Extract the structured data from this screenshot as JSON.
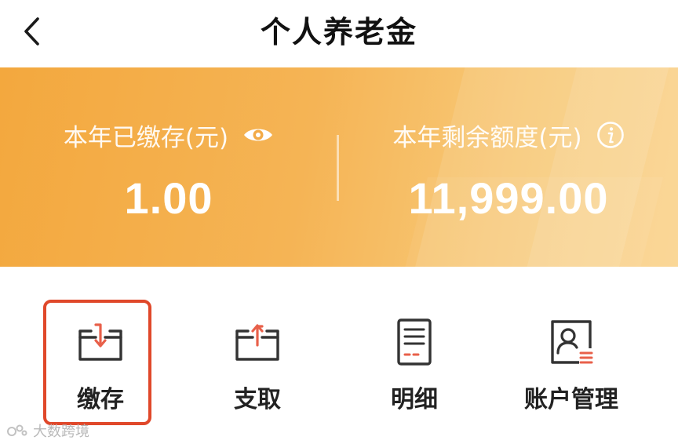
{
  "header": {
    "title": "个人养老金",
    "back_icon": "chevron-left-icon"
  },
  "banner": {
    "colors": {
      "gradient_start": "#f3a83e",
      "gradient_end": "#fad38c",
      "text": "#ffffff"
    },
    "paid": {
      "label": "本年已缴存(元)",
      "value": "1.00",
      "icon": "eye-icon"
    },
    "remaining": {
      "label": "本年剩余额度(元)",
      "value": "11,999.00",
      "icon": "info-icon"
    }
  },
  "actions": [
    {
      "label": "缴存",
      "icon": "deposit-icon",
      "highlighted": true
    },
    {
      "label": "支取",
      "icon": "withdraw-icon",
      "highlighted": false
    },
    {
      "label": "明细",
      "icon": "document-icon",
      "highlighted": false
    },
    {
      "label": "账户管理",
      "icon": "account-card-icon",
      "highlighted": false
    }
  ],
  "accent_color": "#e0482a",
  "watermark": {
    "text": "大数跨境"
  }
}
